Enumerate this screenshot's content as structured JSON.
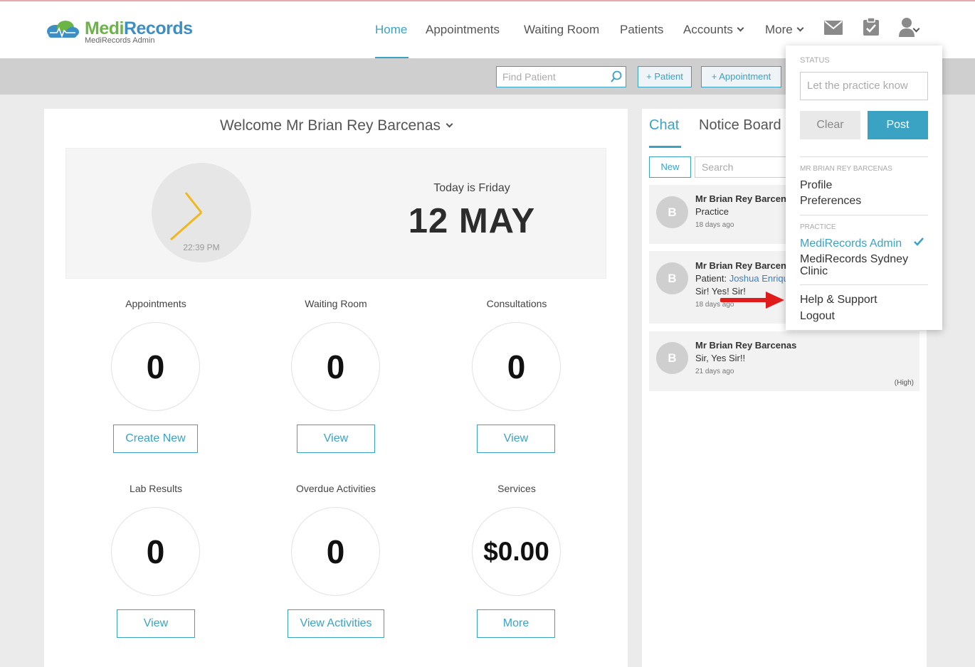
{
  "brand": {
    "name_part1": "Medi",
    "name_part2": "Records",
    "subtitle": "MediRecords Admin"
  },
  "nav": {
    "home": "Home",
    "appointments": "Appointments",
    "waiting_room": "Waiting Room",
    "patients": "Patients",
    "accounts": "Accounts",
    "more": "More"
  },
  "toolbar": {
    "find_placeholder": "Find Patient",
    "add_patient": "+ Patient",
    "add_appointment": "+ Appointment"
  },
  "welcome": "Welcome Mr Brian Rey Barcenas",
  "clock": {
    "time": "22:39 PM",
    "today": "Today is Friday",
    "date": "12 MAY"
  },
  "stats": [
    {
      "label": "Appointments",
      "value": "0",
      "button": "Create New"
    },
    {
      "label": "Waiting Room",
      "value": "0",
      "button": "View"
    },
    {
      "label": "Consultations",
      "value": "0",
      "button": "View"
    },
    {
      "label": "Lab Results",
      "value": "0",
      "button": "View"
    },
    {
      "label": "Overdue Activities",
      "value": "0",
      "button": "View Activities"
    },
    {
      "label": "Services",
      "value": "$0.00",
      "button": "More"
    }
  ],
  "sidebar": {
    "tab_chat": "Chat",
    "tab_notice": "Notice Board",
    "new_button": "New",
    "search_placeholder": "Search",
    "messages": [
      {
        "initial": "B",
        "name": "Mr Brian Rey Barcenas",
        "line1": "Practice",
        "time": "18 days ago"
      },
      {
        "initial": "B",
        "name": "Mr Brian Rey Barcenas",
        "line1_prefix": "Patient: ",
        "line1_link": "Joshua Enriquez",
        "line2": "Sir! Yes! Sir!",
        "time": "18 days ago"
      },
      {
        "initial": "B",
        "name": "Mr Brian Rey Barcenas",
        "line1": "Sir, Yes Sir!!",
        "time": "21 days ago",
        "priority": "(High)"
      }
    ]
  },
  "dropdown": {
    "status_heading": "STATUS",
    "status_placeholder": "Let the practice know",
    "clear": "Clear",
    "post": "Post",
    "user_heading": "MR BRIAN REY BARCENAS",
    "profile": "Profile",
    "preferences": "Preferences",
    "practice_heading": "PRACTICE",
    "practice_active": "MediRecords Admin",
    "practice_other_1": "MediRecords Sydney",
    "practice_other_2": "Clinic",
    "help": "Help & Support",
    "logout": "Logout"
  },
  "colors": {
    "accent": "#3aa3c4",
    "brand_green": "#6bb446",
    "brand_blue": "#3b8fc4",
    "annotation_arrow": "#e01b1b"
  }
}
